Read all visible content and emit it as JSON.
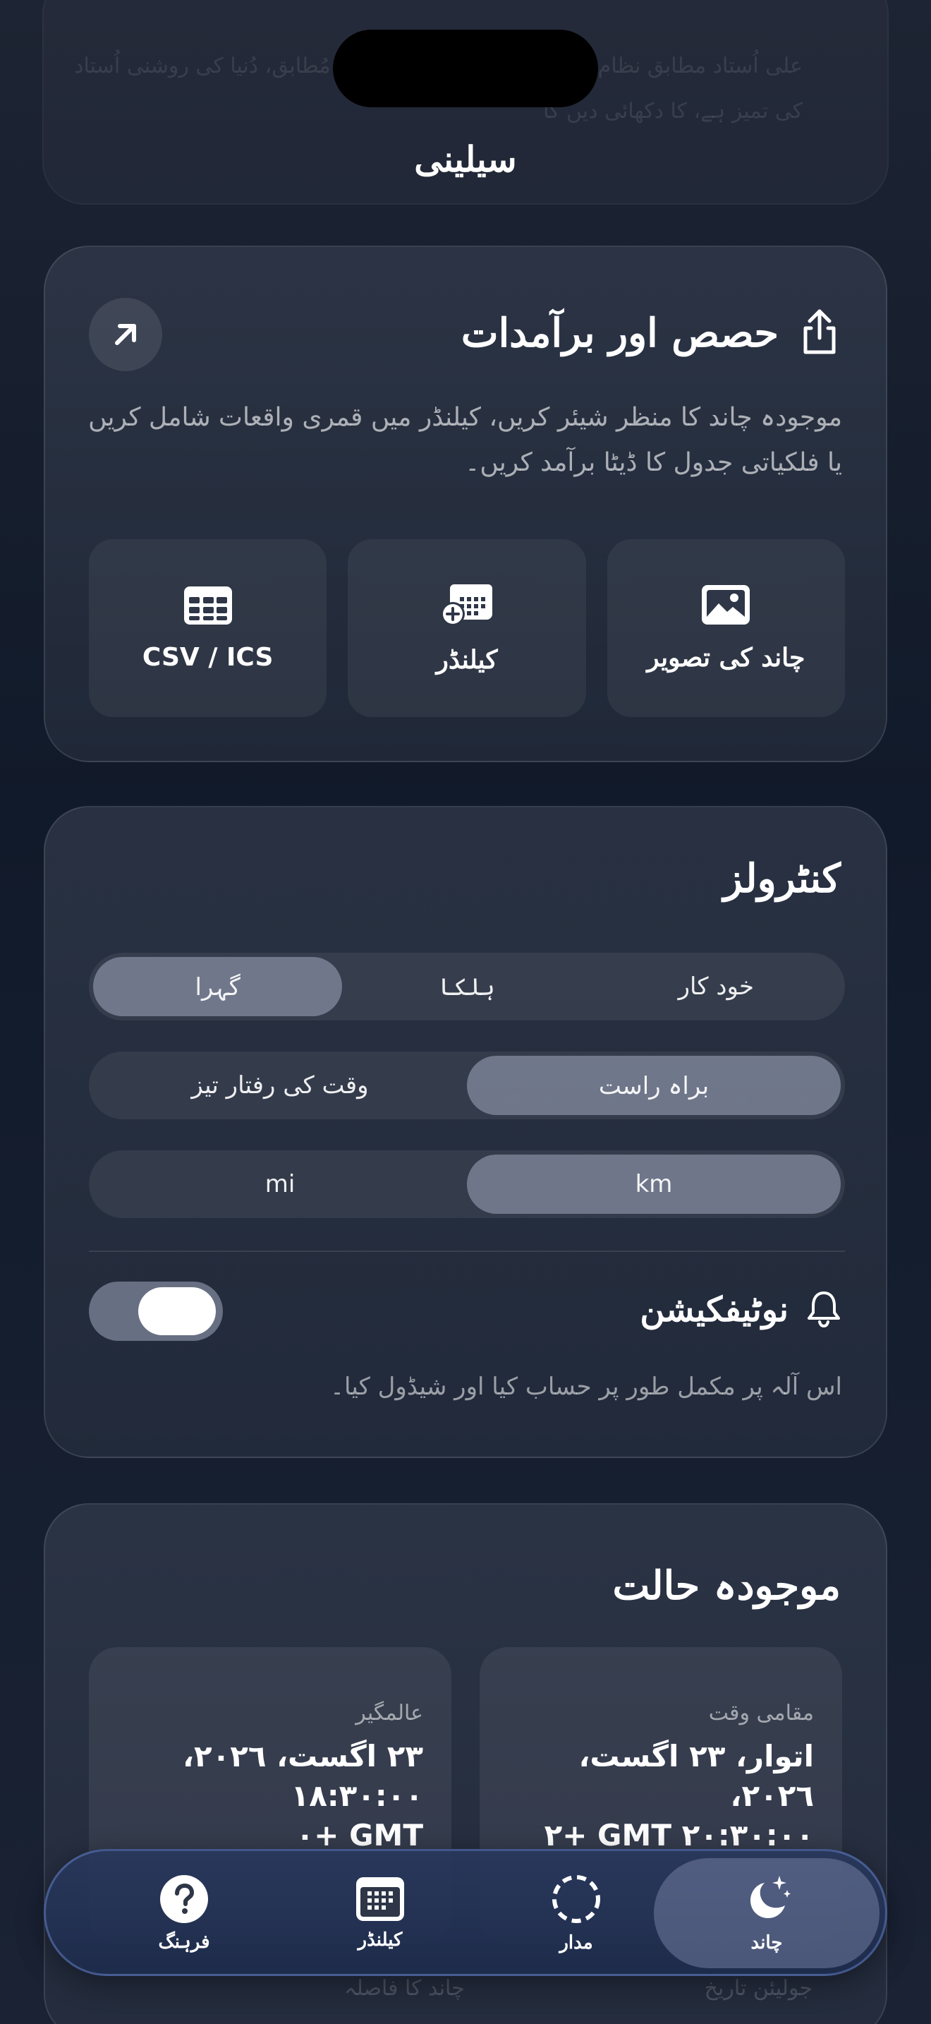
{
  "background": {
    "ghost_text": "علی اُستاد مطابق نظام، جاند کی تمیز ظاہر کرتا ہے، مُطابق، دُنیا کی روشنی اُستاد کی تمیز ہے، کا دکھائی دیں گا"
  },
  "app": {
    "title": "سیلینی"
  },
  "share": {
    "title": "حصص اور برآمدات",
    "description": "موجودہ چاند کا منظر شیئر کریں، کیلنڈر میں قمری واقعات شامل کریں یا فلکیاتی جدول کا ڈیٹا برآمد کریں۔",
    "tiles": [
      {
        "label": "چاند کی تصویر",
        "icon": "image-icon"
      },
      {
        "label": "کیلنڈر",
        "icon": "calendar-add-icon"
      },
      {
        "label": "CSV / ICS",
        "icon": "table-icon"
      }
    ]
  },
  "controls": {
    "title": "کنٹرولز",
    "theme_options": [
      "خود کار",
      "ہلکا",
      "گہرا"
    ],
    "theme_selected": "گہرا",
    "mode_options": [
      "براہ راست",
      "وقت کی رفتار تیز"
    ],
    "mode_selected": "براہ راست",
    "unit_options": [
      "km",
      "mi"
    ],
    "unit_selected": "km",
    "notifications_label": "نوٹیفکیشن",
    "notifications_on": true,
    "notifications_desc": "اس آلہ پر مکمل طور پر حساب کیا اور شیڈول کیا۔"
  },
  "status": {
    "title": "موجودہ حالت",
    "local_label": "مقامی وقت",
    "local_value_line1": "اتوار، ٢٣ اگست، ٢٠٢٦،",
    "local_value_line2": "٢٠:٣٠:٠٠ GMT +٢",
    "universal_label": "عالمگیر",
    "universal_value_line1": "٢٣ اگست، ٢٠٢٦، ١٨:٣٠:٠٠",
    "universal_value_line2": "GMT +٠",
    "below_left": "چاند کا فاصلہ",
    "below_right": "جولیئن تاریخ"
  },
  "tabbar": {
    "tabs": [
      {
        "label": "چاند",
        "icon": "moon-stars-icon",
        "active": true
      },
      {
        "label": "مدار",
        "icon": "orbit-icon",
        "active": false
      },
      {
        "label": "کیلنڈر",
        "icon": "calendar-icon",
        "active": false
      },
      {
        "label": "فرہنگ",
        "icon": "help-icon",
        "active": false
      }
    ]
  },
  "colors": {
    "accent": "#a0a8be",
    "background": "#141d2e",
    "tabbar_border": "#6e8cdc"
  }
}
